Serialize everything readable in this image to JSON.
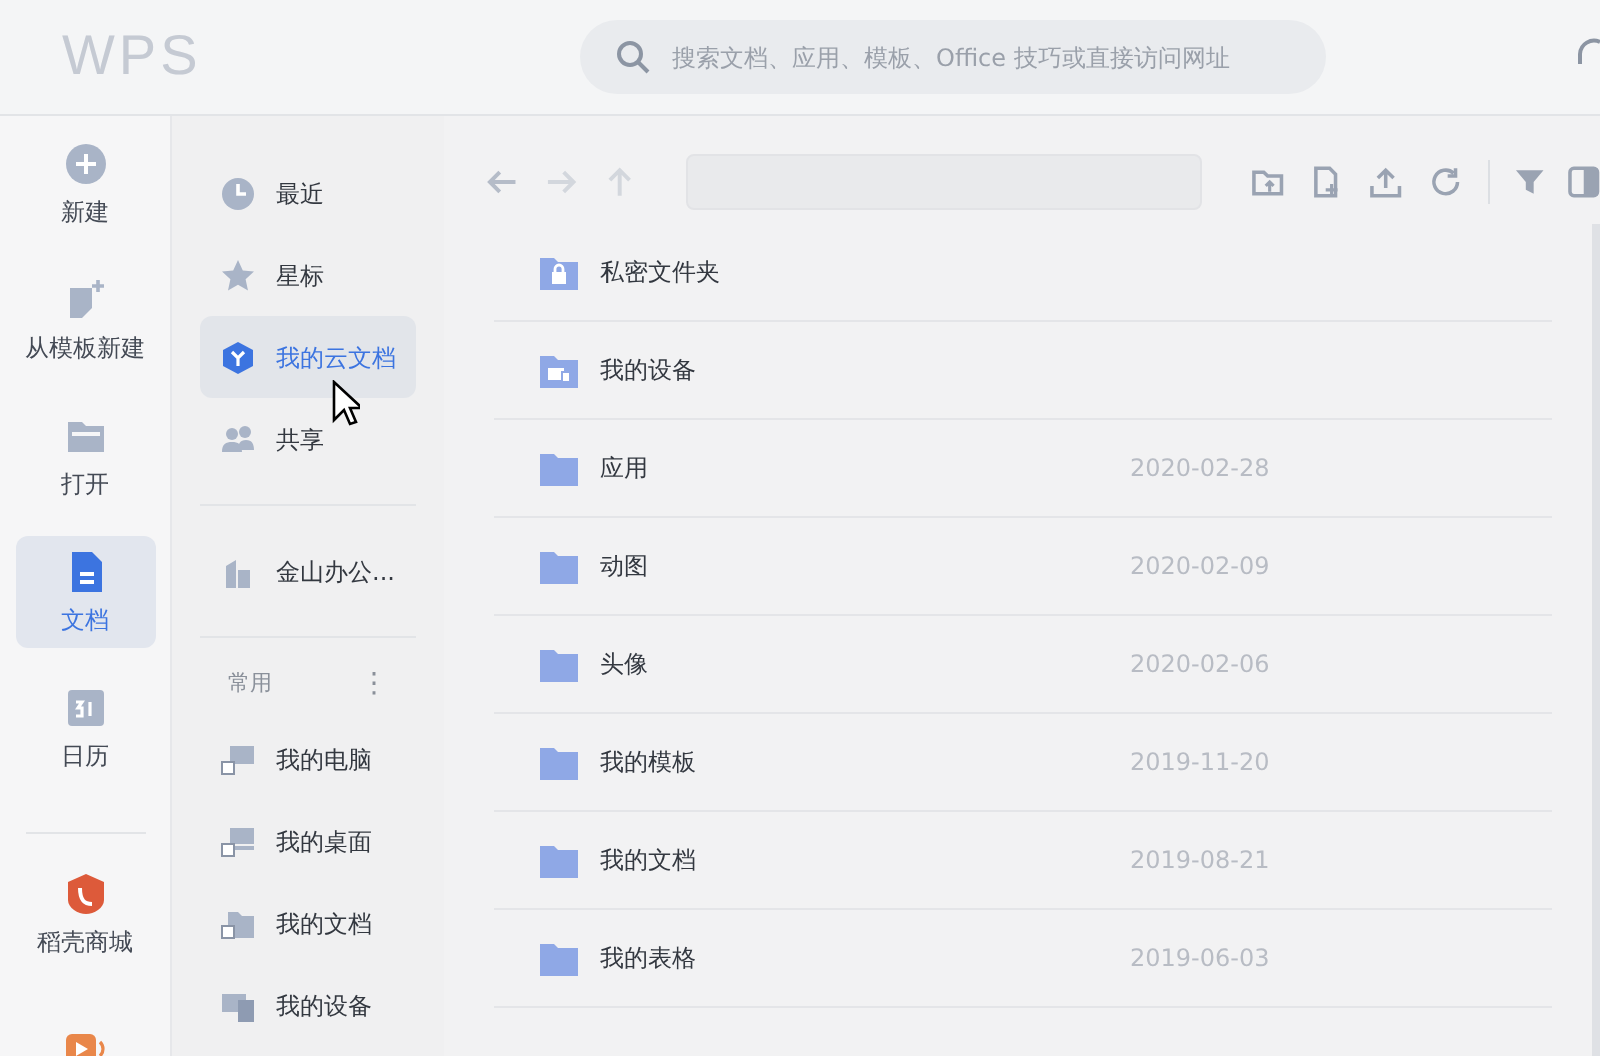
{
  "logo": "WPS",
  "search": {
    "placeholder": "搜索文档、应用、模板、Office 技巧或直接访问网址"
  },
  "rail": [
    {
      "kind": "plus",
      "label": "新建",
      "selected": false
    },
    {
      "kind": "template",
      "label": "从模板新建",
      "selected": false
    },
    {
      "kind": "folder",
      "label": "打开",
      "selected": false
    },
    {
      "kind": "doc",
      "label": "文档",
      "selected": true
    },
    {
      "kind": "calendar",
      "label": "日历",
      "selected": false
    },
    {
      "kind": "divider"
    },
    {
      "kind": "shop",
      "label": "稻壳商城",
      "selected": false
    },
    {
      "kind": "video",
      "selected": false
    }
  ],
  "nav": {
    "top": [
      {
        "kind": "clock",
        "label": "最近",
        "selected": false
      },
      {
        "kind": "star",
        "label": "星标",
        "selected": false
      },
      {
        "kind": "cloud",
        "label": "我的云文档",
        "selected": true
      },
      {
        "kind": "people",
        "label": "共享",
        "selected": false
      }
    ],
    "org": [
      {
        "kind": "building",
        "label": "金山办公...",
        "selected": false
      }
    ],
    "section": {
      "title": "常用",
      "menu": "⋮"
    },
    "common": [
      {
        "kind": "pc",
        "label": "我的电脑",
        "selected": false
      },
      {
        "kind": "desktop",
        "label": "我的桌面",
        "selected": false
      },
      {
        "kind": "docs",
        "label": "我的文档",
        "selected": false
      },
      {
        "kind": "device",
        "label": "我的设备",
        "selected": false
      }
    ]
  },
  "files": [
    {
      "kind": "lock",
      "name": "私密文件夹"
    },
    {
      "kind": "device",
      "name": "我的设备"
    },
    {
      "kind": "folder",
      "name": "应用",
      "date": "2020-02-28"
    },
    {
      "kind": "folder",
      "name": "动图",
      "date": "2020-02-09"
    },
    {
      "kind": "folder",
      "name": "头像",
      "date": "2020-02-06"
    },
    {
      "kind": "folder",
      "name": "我的模板",
      "date": "2019-11-20"
    },
    {
      "kind": "folder",
      "name": "我的文档",
      "date": "2019-08-21"
    },
    {
      "kind": "folder",
      "name": "我的表格",
      "date": "2019-06-03"
    }
  ]
}
